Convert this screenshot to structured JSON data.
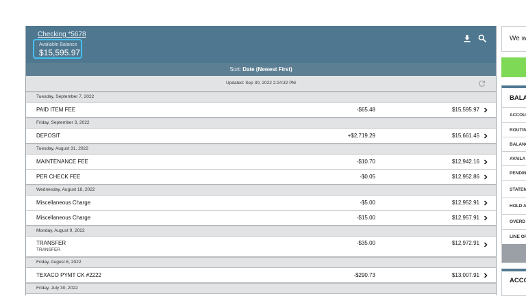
{
  "account": {
    "name": "Checking *5678",
    "balance_label": "Available Balance",
    "balance_value": "$15,595.97",
    "download_icon": "download-icon",
    "search_icon": "search-icon"
  },
  "sort": {
    "label": "Sort:",
    "value": "Date (Newest First)"
  },
  "updated": {
    "text": "Updated: Sep 30, 2022 2:24:32 PM",
    "refresh_icon": "refresh-icon"
  },
  "groups": [
    {
      "date": "Tuesday, September 7, 2022",
      "transactions": [
        {
          "description": "PAID ITEM FEE",
          "amount": "-$65.48",
          "balance": "$15,595.97"
        }
      ]
    },
    {
      "date": "Friday, September 3, 2022",
      "transactions": [
        {
          "description": "DEPOSIT",
          "amount": "+$2,719.29",
          "balance": "$15,661.45"
        }
      ]
    },
    {
      "date": "Tuesday, August 31, 2022",
      "transactions": [
        {
          "description": "MAINTENANCE FEE",
          "amount": "-$10.70",
          "balance": "$12,942.16"
        },
        {
          "description": "PER CHECK FEE",
          "amount": "-$0.05",
          "balance": "$12,952.86"
        }
      ]
    },
    {
      "date": "Wednesday, August 18, 2022",
      "transactions": [
        {
          "description": "Miscellaneous Charge",
          "amount": "-$5.00",
          "balance": "$12,952.91"
        },
        {
          "description": "Miscellaneous Charge",
          "amount": "-$15.00",
          "balance": "$12,957.91"
        }
      ]
    },
    {
      "date": "Monday, August 9, 2022",
      "transactions": [
        {
          "description": "TRANSFER",
          "subtext": "TRANSFER",
          "amount": "-$35.00",
          "balance": "$12,972.91"
        }
      ]
    },
    {
      "date": "Friday, August 6, 2022",
      "transactions": [
        {
          "description": "TEXACO PYMT CK #2222",
          "amount": "-$290.73",
          "balance": "$13,007.91"
        }
      ]
    },
    {
      "date": "Friday, July 30, 2022",
      "transactions": []
    }
  ],
  "right_panel": {
    "banner_text": "We w",
    "balances_title": "BALA",
    "balance_items": [
      "ACCOU",
      "ROUTIN",
      "BALANC",
      "AVAILA",
      "PENDIN",
      "STATEM",
      "HOLD A",
      "OVERD",
      "LINE OF"
    ],
    "accounts_title": "ACCO"
  },
  "colors": {
    "header": "#4f7890",
    "sort_bar": "#5d7f93",
    "highlight": "#45c0f0",
    "green_button": "#7ed957"
  }
}
